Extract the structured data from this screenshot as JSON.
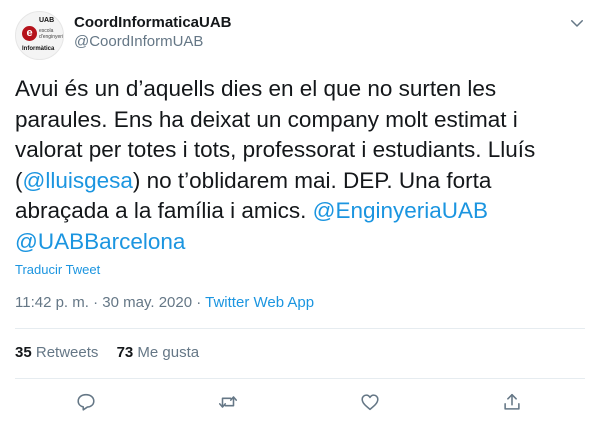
{
  "author": {
    "display_name": "CoordInformaticaUAB",
    "handle": "@CoordInformUAB",
    "avatar_text": {
      "e": "e",
      "uab": "UAB",
      "school": "escola d'enginyeria",
      "informatica": "Informàtica"
    }
  },
  "tweet": {
    "segments": [
      {
        "text": "Avui és un d’aquells dies en el que no surten les paraules. Ens ha deixat un company molt estimat i valorat per totes i tots, professorat i estudiants. Lluís (",
        "type": "text"
      },
      {
        "text": "@lluisgesa",
        "type": "mention"
      },
      {
        "text": ") no t’oblidarem mai. DEP. Una forta abraçada a la família i amics. ",
        "type": "text"
      },
      {
        "text": "@EnginyeriaUAB",
        "type": "mention"
      },
      {
        "text": " ",
        "type": "text"
      },
      {
        "text": "@UABBarcelona",
        "type": "mention"
      }
    ],
    "translate_label": "Traducir Tweet",
    "time": "11:42 p. m.",
    "date": "30 may. 2020",
    "separator": "·",
    "source": "Twitter Web App"
  },
  "stats": {
    "retweets_count": "35",
    "retweets_label": "Retweets",
    "likes_count": "73",
    "likes_label": "Me gusta"
  },
  "icons": {
    "menu": "chevron-down-icon",
    "reply": "reply-icon",
    "retweet": "retweet-icon",
    "like": "heart-icon",
    "share": "share-icon"
  },
  "colors": {
    "link": "#1b95e0",
    "text": "#14171a",
    "secondary": "#657786",
    "divider": "#e6ecf0"
  }
}
